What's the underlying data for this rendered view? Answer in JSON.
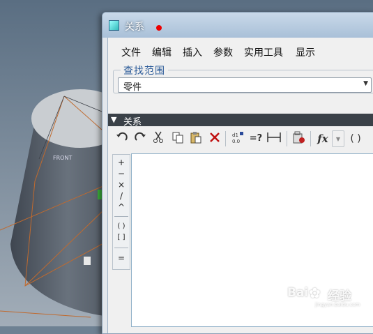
{
  "background": {
    "viewport_label": "FRONT",
    "colors": {
      "sky_top": "#5a6e82",
      "sky_bottom": "#9aa6b2",
      "solid": "#59616c",
      "top_face": "#c8ccd0",
      "edges": "#c06a2e"
    }
  },
  "dialog": {
    "title": "关系",
    "title_color": "#ffffff",
    "menu": [
      "文件",
      "编辑",
      "插入",
      "参数",
      "实用工具",
      "显示"
    ],
    "find_scope": {
      "label": "查找范围",
      "selected": "零件"
    },
    "section_title": "关系",
    "toolbar_icons": [
      "undo-icon",
      "redo-icon",
      "cut-icon",
      "copy-icon",
      "paste-icon",
      "delete-icon",
      "sort-relations-icon",
      "evaluate-icon",
      "dimension-icon",
      "units-icon",
      "function-icon",
      "brackets-icon"
    ],
    "toolbar_text": {
      "evaluate": "=?",
      "function": "fx",
      "brackets": "( )"
    },
    "operators": [
      "+",
      "−",
      "×",
      "/",
      "^",
      "( )",
      "[ ]",
      "="
    ],
    "editor_value": ""
  },
  "watermark": {
    "text": "Bai",
    "suffix": "经验",
    "site": "jingyan.baidu.com"
  }
}
